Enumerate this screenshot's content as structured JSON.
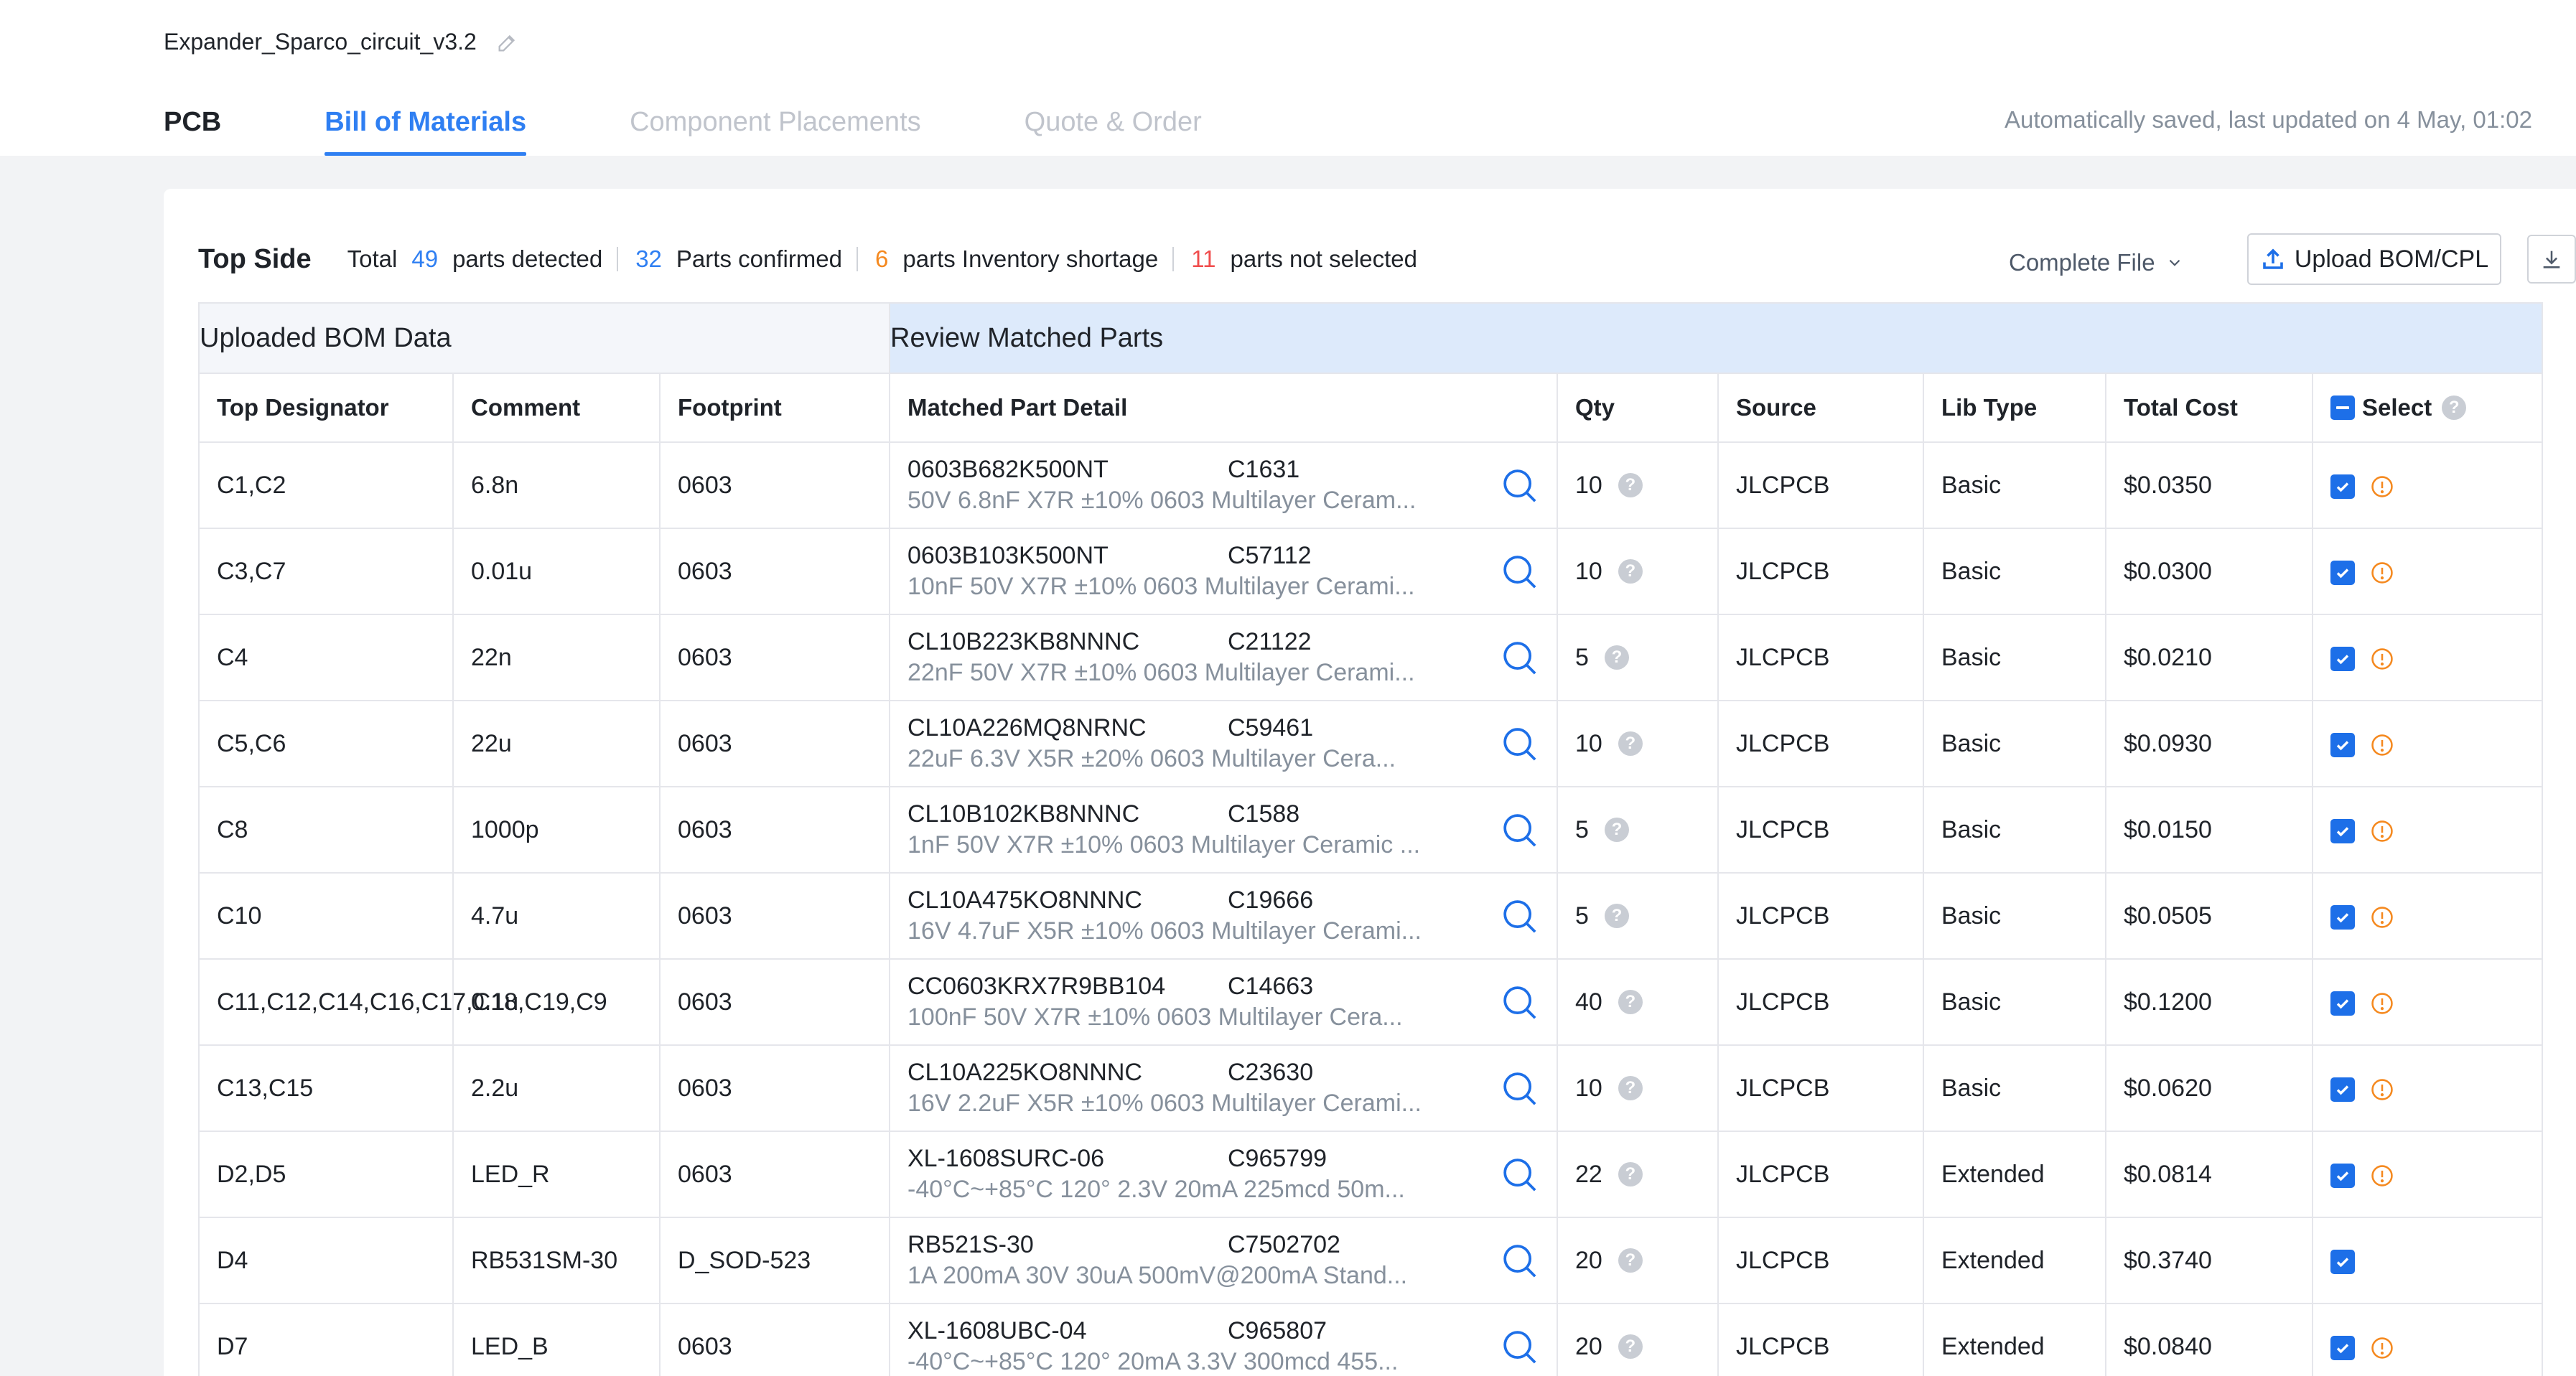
{
  "header": {
    "project_name": "Expander_Sparco_circuit_v3.2",
    "tabs": [
      {
        "label": "PCB"
      },
      {
        "label": "Bill of Materials"
      },
      {
        "label": "Component Placements"
      },
      {
        "label": "Quote & Order"
      }
    ],
    "saved_text": "Automatically saved, last updated on 4 May, 01:02"
  },
  "summary": {
    "side_title": "Top Side",
    "total_label": "Total",
    "total_count": "49",
    "total_suffix": "parts detected",
    "confirmed_count": "32",
    "confirmed_label": "Parts confirmed",
    "shortage_count": "6",
    "shortage_label": "parts Inventory shortage",
    "not_selected_count": "11",
    "not_selected_label": "parts not selected",
    "complete_file_label": "Complete File",
    "upload_label": "Upload BOM/CPL"
  },
  "table": {
    "group_uploaded": "Uploaded BOM Data",
    "group_review": "Review Matched Parts",
    "columns": {
      "designator": "Top Designator",
      "comment": "Comment",
      "footprint": "Footprint",
      "matched": "Matched Part Detail",
      "qty": "Qty",
      "source": "Source",
      "lib_type": "Lib Type",
      "total_cost": "Total Cost",
      "select": "Select"
    },
    "rows": [
      {
        "designator": "C1,C2",
        "comment": "6.8n",
        "footprint": "0603",
        "part": "0603B682K500NT",
        "code": "C1631",
        "desc": "50V 6.8nF X7R ±10% 0603 Multilayer Ceram...",
        "qty": "10",
        "source": "JLCPCB",
        "lib": "Basic",
        "cost": "$0.0350",
        "warn": true
      },
      {
        "designator": "C3,C7",
        "comment": "0.01u",
        "footprint": "0603",
        "part": "0603B103K500NT",
        "code": "C57112",
        "desc": "10nF 50V X7R ±10% 0603 Multilayer Cerami...",
        "qty": "10",
        "source": "JLCPCB",
        "lib": "Basic",
        "cost": "$0.0300",
        "warn": true
      },
      {
        "designator": "C4",
        "comment": "22n",
        "footprint": "0603",
        "part": "CL10B223KB8NNNC",
        "code": "C21122",
        "desc": "22nF 50V X7R ±10% 0603 Multilayer Cerami...",
        "qty": "5",
        "source": "JLCPCB",
        "lib": "Basic",
        "cost": "$0.0210",
        "warn": true
      },
      {
        "designator": "C5,C6",
        "comment": "22u",
        "footprint": "0603",
        "part": "CL10A226MQ8NRNC",
        "code": "C59461",
        "desc": "22uF 6.3V X5R ±20% 0603 Multilayer Cera...",
        "qty": "10",
        "source": "JLCPCB",
        "lib": "Basic",
        "cost": "$0.0930",
        "warn": true
      },
      {
        "designator": "C8",
        "comment": "1000p",
        "footprint": "0603",
        "part": "CL10B102KB8NNNC",
        "code": "C1588",
        "desc": "1nF 50V X7R ±10% 0603 Multilayer Ceramic ...",
        "qty": "5",
        "source": "JLCPCB",
        "lib": "Basic",
        "cost": "$0.0150",
        "warn": true
      },
      {
        "designator": "C10",
        "comment": "4.7u",
        "footprint": "0603",
        "part": "CL10A475KO8NNNC",
        "code": "C19666",
        "desc": "16V 4.7uF X5R ±10% 0603 Multilayer Cerami...",
        "qty": "5",
        "source": "JLCPCB",
        "lib": "Basic",
        "cost": "$0.0505",
        "warn": true
      },
      {
        "designator": "C11,C12,C14,C16,C17,C18,C19,C9",
        "comment": "0.1u",
        "footprint": "0603",
        "part": "CC0603KRX7R9BB104",
        "code": "C14663",
        "desc": "100nF 50V X7R ±10% 0603 Multilayer Cera...",
        "qty": "40",
        "source": "JLCPCB",
        "lib": "Basic",
        "cost": "$0.1200",
        "warn": true
      },
      {
        "designator": "C13,C15",
        "comment": "2.2u",
        "footprint": "0603",
        "part": "CL10A225KO8NNNC",
        "code": "C23630",
        "desc": "16V 2.2uF X5R ±10% 0603 Multilayer Cerami...",
        "qty": "10",
        "source": "JLCPCB",
        "lib": "Basic",
        "cost": "$0.0620",
        "warn": true
      },
      {
        "designator": "D2,D5",
        "comment": "LED_R",
        "footprint": "0603",
        "part": "XL-1608SURC-06",
        "code": "C965799",
        "desc": "-40°C~+85°C 120° 2.3V 20mA 225mcd 50m...",
        "qty": "22",
        "source": "JLCPCB",
        "lib": "Extended",
        "cost": "$0.0814",
        "warn": true
      },
      {
        "designator": "D4",
        "comment": "RB531SM-30",
        "footprint": "D_SOD-523",
        "part": "RB521S-30",
        "code": "C7502702",
        "desc": "1A 200mA 30V 30uA 500mV@200mA Stand...",
        "qty": "20",
        "source": "JLCPCB",
        "lib": "Extended",
        "cost": "$0.3740",
        "warn": false
      },
      {
        "designator": "D7",
        "comment": "LED_B",
        "footprint": "0603",
        "part": "XL-1608UBC-04",
        "code": "C965807",
        "desc": "-40°C~+85°C 120° 20mA 3.3V 300mcd 455...",
        "qty": "20",
        "source": "JLCPCB",
        "lib": "Extended",
        "cost": "$0.0840",
        "warn": true
      }
    ]
  },
  "colors": {
    "accent": "#2f7ff2",
    "warning": "#f5891f",
    "error": "#f04d4d",
    "checkbox": "#1d6fe8"
  }
}
